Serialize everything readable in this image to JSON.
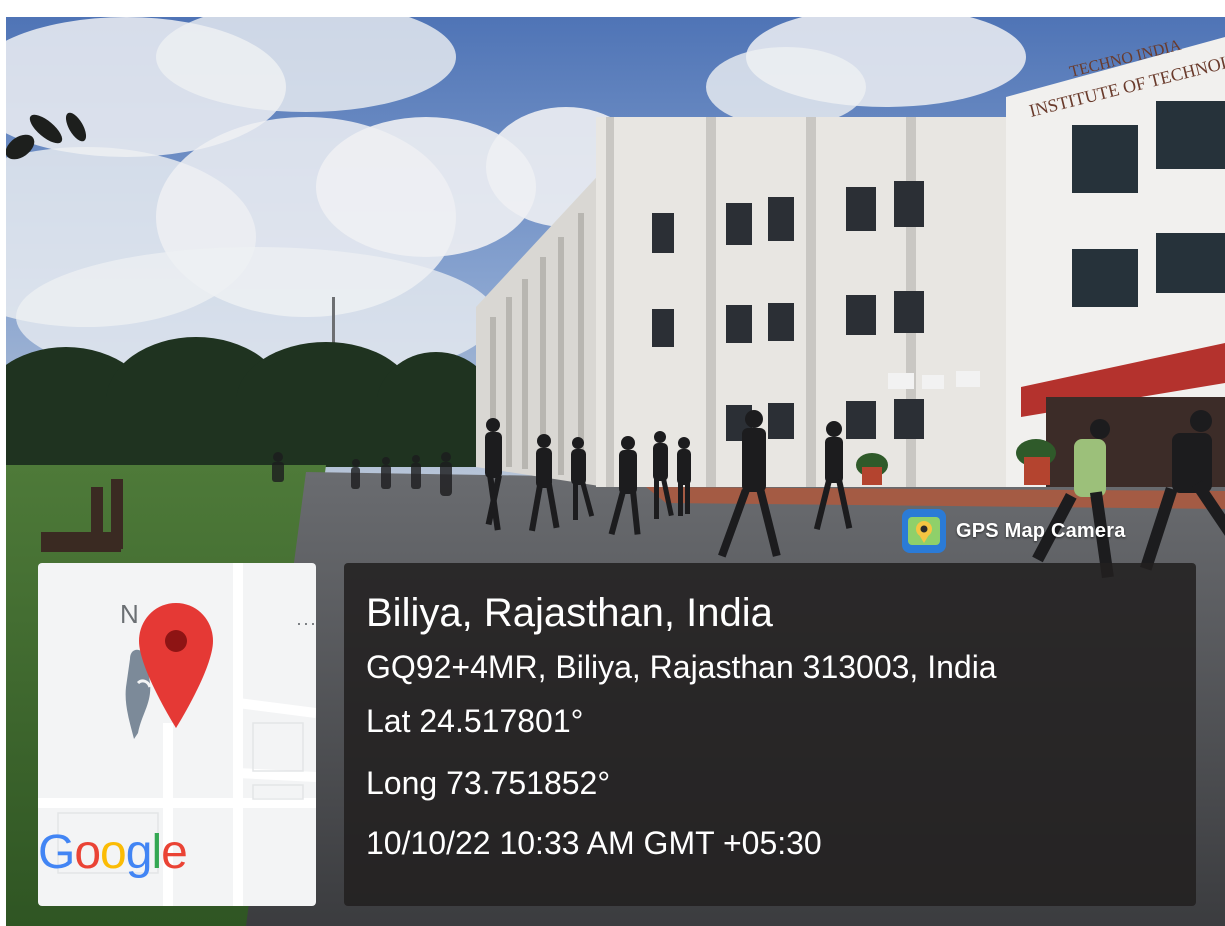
{
  "building_sign": {
    "line1": "TECHNO INDIA",
    "line2": "INSTITUTE OF TECHNOLOGY"
  },
  "badge": {
    "icon": "gps-map-camera-app-icon",
    "label": "GPS Map Camera"
  },
  "map": {
    "north_label": "N",
    "dots": "···",
    "brand": [
      "G",
      "o",
      "o",
      "g",
      "l",
      "e"
    ],
    "brand_colors": [
      "#4285F4",
      "#EA4335",
      "#FBBC05",
      "#4285F4",
      "#34A853",
      "#EA4335"
    ],
    "pin_icon": "location-pin-icon",
    "pin_color": "#E53935"
  },
  "location": {
    "place": "Biliya, Rajasthan, India",
    "address": "GQ92+4MR, Biliya, Rajasthan 313003, India",
    "latitude": "Lat 24.517801°",
    "longitude": "Long 73.751852°",
    "datetime": "10/10/22 10:33 AM GMT +05:30"
  }
}
